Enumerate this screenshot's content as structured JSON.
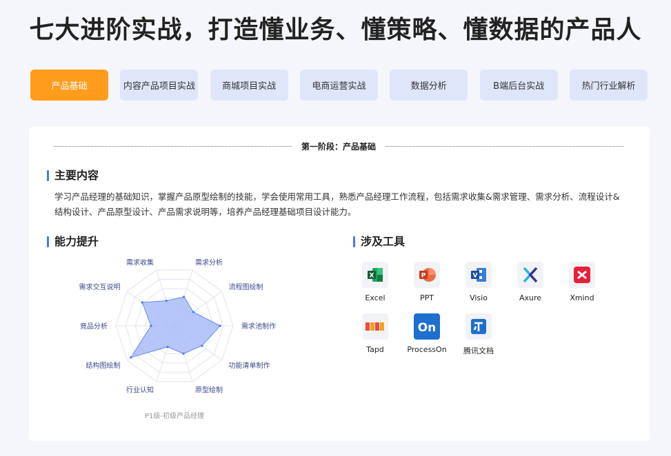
{
  "headline": "七大进阶实战，打造懂业务、懂策略、懂数据的产品人",
  "tabs": [
    "产品基础",
    "内容产品项目实战",
    "商城项目实战",
    "电商运营实战",
    "数据分析",
    "B端后台实战",
    "热门行业解析"
  ],
  "active_tab": "产品基础",
  "stage_title": "第一阶段：产品基础",
  "main_content": {
    "title": "主要内容",
    "text": "学习产品经理的基础知识，掌握产品原型绘制的技能，学会使用常用工具，熟悉产品经理工作流程，包括需求收集&需求管理、需求分析、流程设计&结构设计、产品原型设计、产品需求说明等，培养产品经理基础项目设计能力。"
  },
  "ability": {
    "title": "能力提升",
    "radar_axes": [
      "需求分析",
      "流程图绘制",
      "需求池制作",
      "功能清单制作",
      "原型绘制",
      "行业认知",
      "结构图绘制",
      "竟品分析",
      "需求交互说明",
      "需求收集"
    ],
    "radar_values": [
      0.52,
      0.4,
      0.78,
      0.58,
      0.5,
      0.38,
      0.92,
      0.4,
      0.68,
      0.45
    ],
    "caption": "P1级-初级产品经理",
    "fill_color": "#a9bcf8",
    "line_color": "#4e74f5"
  },
  "tools": {
    "title": "涉及工具",
    "items": [
      {
        "name": "Excel",
        "icon": "excel-icon"
      },
      {
        "name": "PPT",
        "icon": "ppt-icon"
      },
      {
        "name": "Visio",
        "icon": "visio-icon"
      },
      {
        "name": "Axure",
        "icon": "axure-icon"
      },
      {
        "name": "Xmind",
        "icon": "xmind-icon"
      },
      {
        "name": "Tapd",
        "icon": "tapd-icon"
      },
      {
        "name": "ProcessOn",
        "icon": "processon-icon"
      },
      {
        "name": "腾讯文档",
        "icon": "tencent-docs-icon"
      }
    ]
  },
  "colors": {
    "accent": "#ff9c1e",
    "tab_bg": "#e0e6fa",
    "title_bar": "#4e74f5"
  }
}
